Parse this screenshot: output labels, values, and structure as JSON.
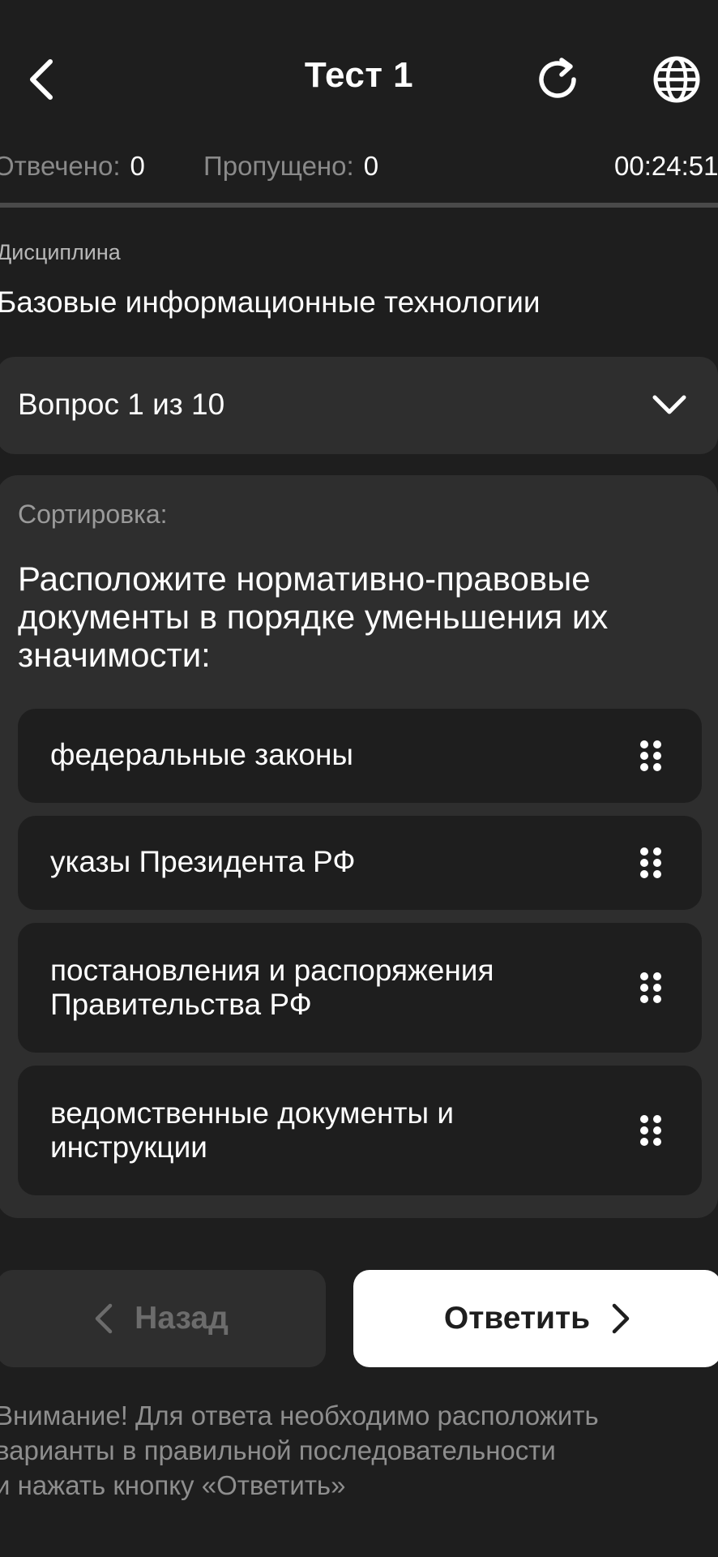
{
  "header": {
    "title": "Тест 1",
    "icons": {
      "back": "chevron-left-icon",
      "reload": "reload-icon",
      "language": "globe-icon"
    }
  },
  "stats": {
    "answered_label": "Отвечено:",
    "answered_value": "0",
    "skipped_label": "Пропущено:",
    "skipped_value": "0",
    "timer": "00:24:51"
  },
  "discipline": {
    "label": "Дисциплина",
    "name": "Базовые информационные технологии"
  },
  "question_selector": {
    "label": "Вопрос 1 из 10"
  },
  "question": {
    "type_label": "Сортировка:",
    "text": "Расположите нормативно-правовые документы в порядке уменьшения их значимости:",
    "options": [
      "федеральные законы",
      "указы Президента РФ",
      "постановления и распоряжения Правительства РФ",
      "ведомственные документы и инструкции"
    ]
  },
  "footer": {
    "back_label": "Назад",
    "submit_label": "Ответить",
    "notice_lines": [
      "Внимание! Для ответа необходимо расположить",
      "варианты в правильной последовательности",
      "и нажать кнопку «Ответить»"
    ]
  },
  "colors": {
    "background": "#1e1e1e",
    "card": "#2e2e2e",
    "muted_text": "#8a8a8a",
    "primary_button": "#ffffff"
  }
}
